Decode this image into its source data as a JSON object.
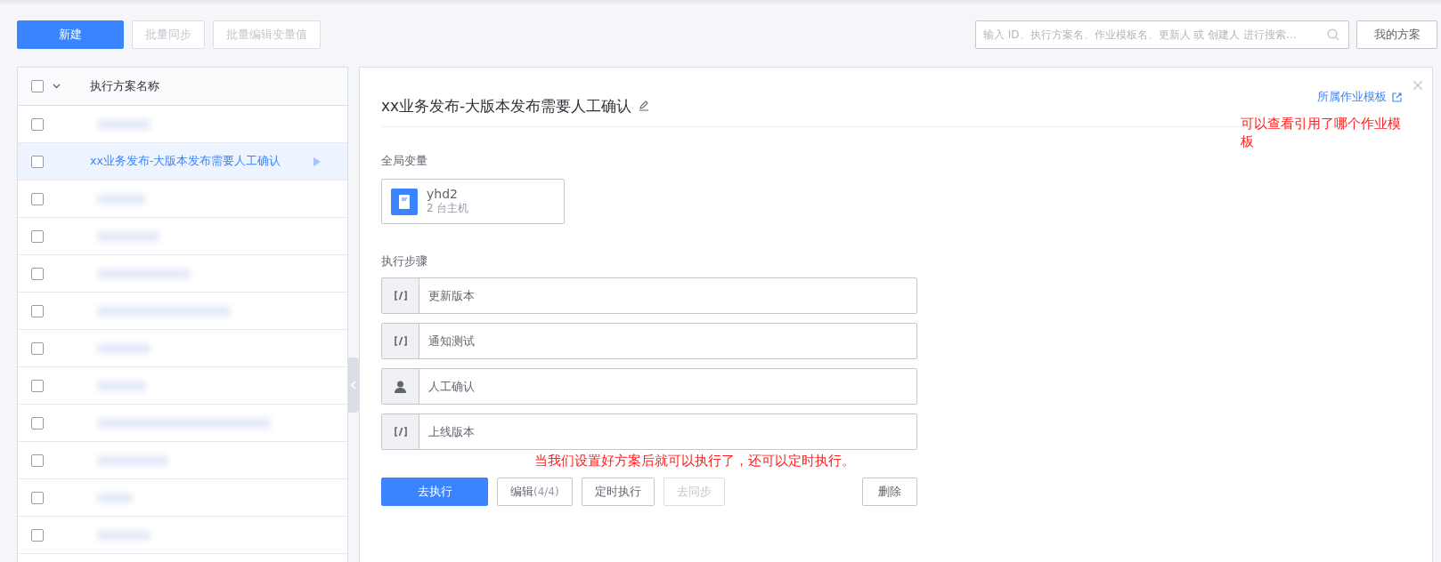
{
  "toolbar": {
    "buttons": [
      {
        "label": "新建",
        "kind": "primary",
        "disabled": false
      },
      {
        "label": "批量同步",
        "kind": "default",
        "disabled": true
      },
      {
        "label": "批量编辑变量值",
        "kind": "default",
        "disabled": true
      }
    ],
    "search": {
      "placeholder": "输入 ID、执行方案名、作业模板名、更新人 或 创建人 进行搜索..."
    },
    "my_plans": "我的方案"
  },
  "list": {
    "header": {
      "checked": false,
      "title": "执行方案名称"
    },
    "rows": [
      {
        "checked": false,
        "selected": false
      },
      {
        "checked": false,
        "selected": true,
        "name": "xx业务发布-大版本发布需要人工确认"
      },
      {
        "checked": false,
        "selected": false
      },
      {
        "checked": false,
        "selected": false
      },
      {
        "checked": false,
        "selected": false
      },
      {
        "checked": false,
        "selected": false
      },
      {
        "checked": false,
        "selected": false
      },
      {
        "checked": false,
        "selected": false
      },
      {
        "checked": false,
        "selected": false
      },
      {
        "checked": false,
        "selected": false
      },
      {
        "checked": false,
        "selected": false
      },
      {
        "checked": false,
        "selected": false
      }
    ]
  },
  "detail": {
    "title": "xx业务发布-大版本发布需要人工确认",
    "template_link": "所属作业模板",
    "note_top": "可以查看引用了哪个作业模板",
    "globals_label": "全局变量",
    "variables": [
      {
        "name": "yhd2",
        "hosts": "2 台主机"
      }
    ],
    "steps_label": "执行步骤",
    "steps": [
      {
        "kind": "script",
        "name": "更新版本"
      },
      {
        "kind": "script",
        "name": "通知测试"
      },
      {
        "kind": "manual",
        "name": "人工确认"
      },
      {
        "kind": "script",
        "name": "上线版本"
      }
    ],
    "note_bottom": "当我们设置好方案后就可以执行了，还可以定时执行。",
    "actions": [
      {
        "label": "去执行",
        "kind": "primary",
        "disabled": false
      },
      {
        "label": "编辑",
        "count": "(4/4)",
        "kind": "default",
        "disabled": false
      },
      {
        "label": "定时执行",
        "kind": "default",
        "disabled": false
      },
      {
        "label": "去同步",
        "kind": "default",
        "disabled": true
      }
    ],
    "delete": "删除"
  }
}
